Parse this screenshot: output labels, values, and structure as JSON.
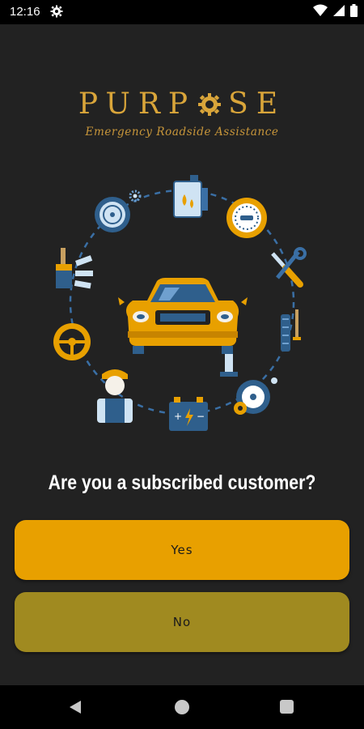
{
  "status_bar": {
    "time": "12:16",
    "icons": [
      "settings-icon",
      "wifi-icon",
      "signal-icon",
      "battery-icon"
    ]
  },
  "logo": {
    "brand": "PURPOSE",
    "brand_before_o": "PURP",
    "brand_after_o": "SE",
    "tagline": "Emergency Roadside Assistance",
    "color": "#d9a53a"
  },
  "illustration": {
    "icons": [
      "fuel-can-icon",
      "speedometer-icon",
      "tools-icon",
      "tire-jack-icon",
      "wheel-icon",
      "battery-icon",
      "mechanic-icon",
      "steering-wheel-icon",
      "paint-brush-icon",
      "tire-icon",
      "car-icon"
    ]
  },
  "question": "Are you a subscribed customer?",
  "buttons": {
    "yes_label": "Yes",
    "no_label": "No",
    "yes_color": "#e8a000",
    "no_color": "#a08a20"
  },
  "nav_bar": {
    "icons": [
      "back-icon",
      "home-icon",
      "recents-icon"
    ]
  }
}
